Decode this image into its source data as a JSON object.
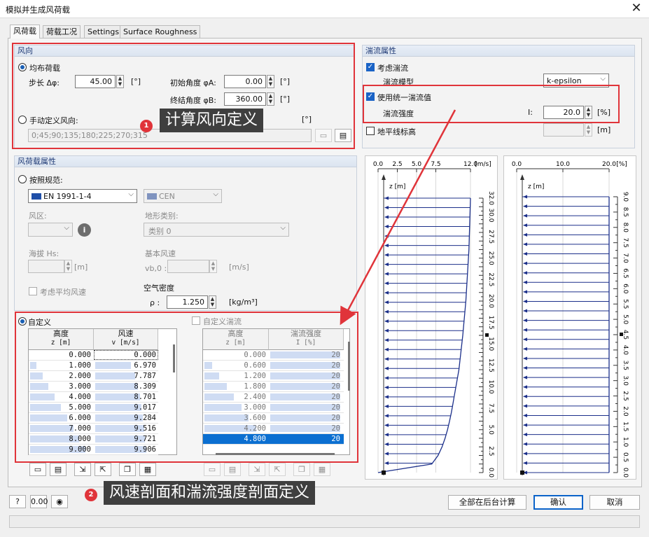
{
  "window": {
    "title": "模拟并生成风荷载",
    "close": "✕"
  },
  "tabs": [
    "风荷载",
    "荷载工况",
    "Settings",
    "Surface Roughness"
  ],
  "direction": {
    "header": "风向",
    "uniform_label": "均布荷载",
    "step_label": "步长 Δφ:",
    "step_value": "45.00",
    "unit_deg": "[°]",
    "start_label": "初始角度 φA:",
    "start_value": "0.00",
    "end_label": "终结角度 φB:",
    "end_value": "360.00",
    "manual_label": "手动定义风向:",
    "manual_value": "0;45;90;135;180;225;270;315"
  },
  "load_props": {
    "header": "风荷载属性",
    "code_label": "按照规范:",
    "code_value": "EN 1991-1-4",
    "annex_value": "CEN",
    "zone_label": "风区:",
    "terrain_label": "地形类别:",
    "terrain_value": "类别 0",
    "altitude_label": "海拔 Hs:",
    "unit_m": "[m]",
    "basic_speed_label": "基本风速",
    "vb0_label": "vb,0 :",
    "unit_ms": "[m/s]",
    "mean_speed_label": "考虑平均风速",
    "density_label": "空气密度",
    "rho_label": "ρ :",
    "rho_value": "1.250",
    "rho_unit": "[kg/m³]"
  },
  "custom": {
    "label": "自定义",
    "col_height": "高度",
    "col_height_sub": "z [m]",
    "col_speed": "风速",
    "col_speed_sub": "v [m/s]",
    "rows": [
      {
        "z": "0.000",
        "v": "0.000"
      },
      {
        "z": "1.000",
        "v": "6.970"
      },
      {
        "z": "2.000",
        "v": "7.787"
      },
      {
        "z": "3.000",
        "v": "8.309"
      },
      {
        "z": "4.000",
        "v": "8.701"
      },
      {
        "z": "5.000",
        "v": "9.017"
      },
      {
        "z": "6.000",
        "v": "9.284"
      },
      {
        "z": "7.000",
        "v": "9.516"
      },
      {
        "z": "8.000",
        "v": "9.721"
      },
      {
        "z": "9.000",
        "v": "9.906"
      }
    ]
  },
  "custom_turb": {
    "label": "自定义湍流",
    "col_height": "高度",
    "col_height_sub": "z [m]",
    "col_int": "湍流强度",
    "col_int_sub": "I [%]",
    "rows": [
      {
        "z": "0.000",
        "i": "20"
      },
      {
        "z": "0.600",
        "i": "20"
      },
      {
        "z": "1.200",
        "i": "20"
      },
      {
        "z": "1.800",
        "i": "20"
      },
      {
        "z": "2.400",
        "i": "20"
      },
      {
        "z": "3.000",
        "i": "20"
      },
      {
        "z": "3.600",
        "i": "20"
      },
      {
        "z": "4.200",
        "i": "20"
      },
      {
        "z": "4.800",
        "i": "20"
      }
    ]
  },
  "turbulence": {
    "header": "湍流属性",
    "consider_label": "考虑湍流",
    "model_label": "湍流模型",
    "model_value": "k-epsilon",
    "uniform_label": "使用统一湍流值",
    "intensity_label": "湍流强度",
    "i_label": "I:",
    "i_value": "20.0",
    "unit_pct": "[%]",
    "terrain_height_label": "地平线标高",
    "unit_m": "[m]"
  },
  "annotations": {
    "c1_num": "1",
    "c1_text": "计算风向定义",
    "c2_num": "2",
    "c2_text": "风速剖面和湍流强度剖面定义"
  },
  "buttons": {
    "calc_bg": "全部在后台计算",
    "ok": "确认",
    "cancel": "取消"
  },
  "chart_data": [
    {
      "type": "line",
      "xlabel": "[m/s]",
      "ylabel": "z [m]",
      "x_ticks": [
        "0.0",
        "2.5",
        "5.0",
        "7.5",
        "12.0"
      ],
      "y_ticks": [
        "32.0",
        "30.0",
        "27.5",
        "25.0",
        "22.5",
        "20.0",
        "17.5",
        "15.0",
        "12.5",
        "10.0",
        "7.5",
        "5.0",
        "2.5",
        "0.0"
      ],
      "xlim": [
        0,
        12
      ],
      "ylim": [
        0,
        32
      ],
      "series": [
        {
          "x": [
            0,
            6.97,
            7.787,
            8.309,
            8.701,
            9.017,
            9.284,
            9.516,
            9.721,
            9.906,
            10.5,
            11.0,
            11.4,
            11.8,
            12.0
          ],
          "y": [
            0,
            1,
            2,
            3,
            4,
            5,
            6,
            7,
            8,
            9,
            12,
            16,
            20,
            26,
            32
          ]
        }
      ]
    },
    {
      "type": "line",
      "xlabel": "[%]",
      "ylabel": "z [m]",
      "x_ticks": [
        "0.0",
        "10.0",
        "20.0"
      ],
      "y_ticks": [
        "9.0",
        "8.5",
        "8.0",
        "7.5",
        "7.0",
        "6.5",
        "6.0",
        "5.5",
        "5.0",
        "4.5",
        "4.0",
        "3.5",
        "3.0",
        "2.5",
        "2.0",
        "1.5",
        "1.0",
        "0.5",
        "0.0"
      ],
      "xlim": [
        0,
        20
      ],
      "ylim": [
        0,
        9
      ],
      "series": [
        {
          "x": [
            20,
            20
          ],
          "y": [
            0,
            9
          ]
        }
      ]
    }
  ]
}
